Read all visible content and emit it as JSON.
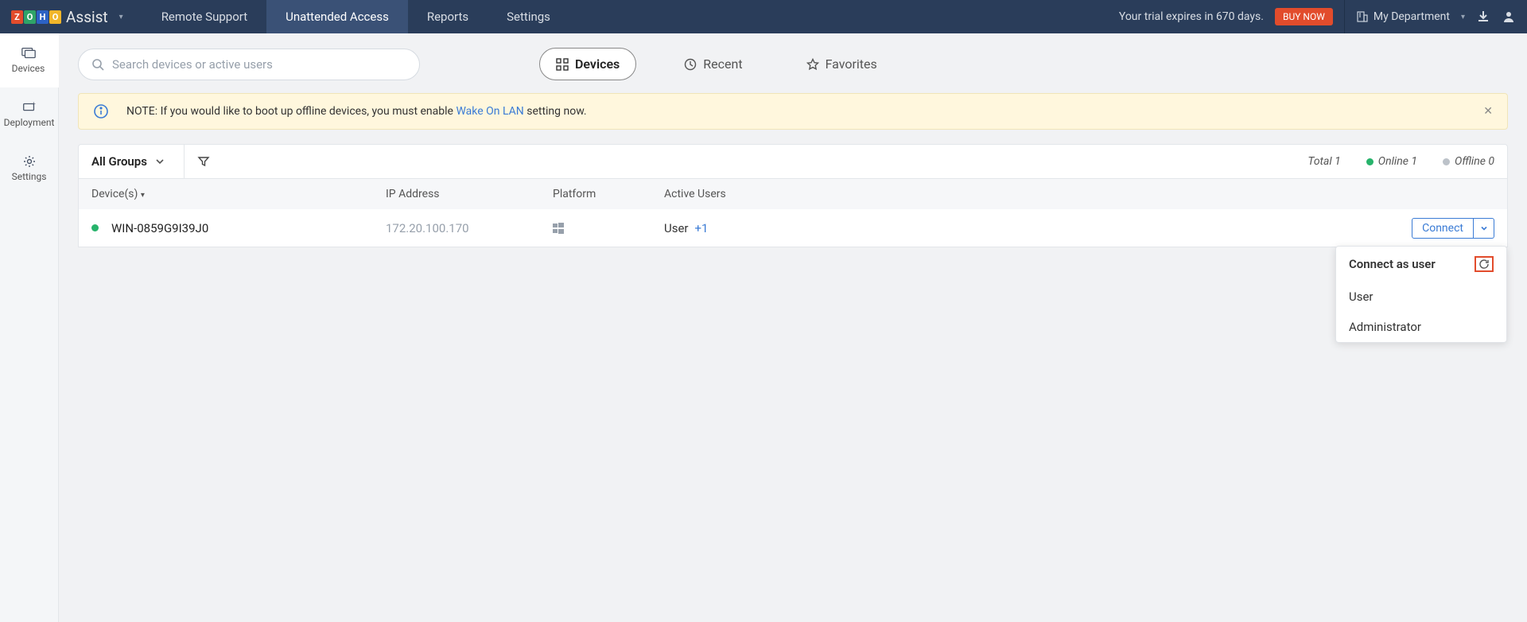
{
  "brand": {
    "name": "Assist"
  },
  "nav": {
    "tabs": [
      "Remote Support",
      "Unattended Access",
      "Reports",
      "Settings"
    ]
  },
  "trial": {
    "message": "Your trial expires in 670 days.",
    "buy": "BUY NOW"
  },
  "department": {
    "label": "My Department"
  },
  "sidebar": {
    "items": [
      {
        "label": "Devices"
      },
      {
        "label": "Deployment"
      },
      {
        "label": "Settings"
      }
    ]
  },
  "search": {
    "placeholder": "Search devices or active users"
  },
  "view_tabs": {
    "devices": "Devices",
    "recent": "Recent",
    "favorites": "Favorites"
  },
  "notice": {
    "prefix": "NOTE: If you would like to boot up offline devices, you must enable ",
    "link": "Wake On LAN",
    "suffix": " setting now."
  },
  "table": {
    "groups_label": "All Groups",
    "stats": {
      "total_label": "Total 1",
      "online_label": "Online 1",
      "offline_label": "Offline 0"
    },
    "columns": {
      "device": "Device(s)",
      "ip": "IP Address",
      "platform": "Platform",
      "users": "Active Users"
    },
    "rows": [
      {
        "name": "WIN-0859G9I39J0",
        "ip": "172.20.100.170",
        "user": "User",
        "more": "+1"
      }
    ],
    "connect_label": "Connect"
  },
  "popup": {
    "title": "Connect as user",
    "items": [
      "User",
      "Administrator"
    ]
  }
}
